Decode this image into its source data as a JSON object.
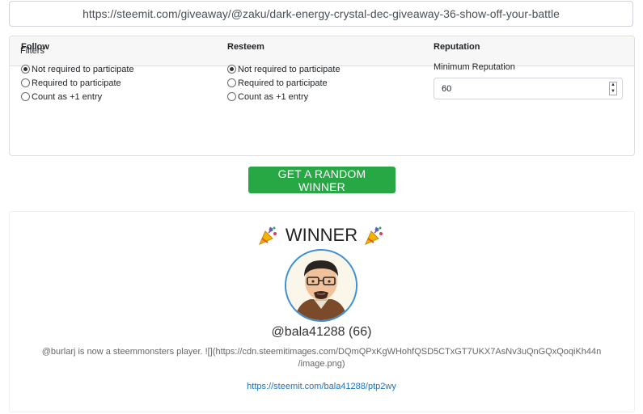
{
  "url": "https://steemit.com/giveaway/@zaku/dark-energy-crystal-dec-giveaway-36-show-off-your-battle",
  "filters": {
    "header": "Filters",
    "follow": {
      "title": "Follow",
      "options": [
        "Not required to participate",
        "Required to participate",
        "Count as +1 entry"
      ],
      "selected": "Not required to participate"
    },
    "resteem": {
      "title": "Resteem",
      "options": [
        "Not required to participate",
        "Required to participate",
        "Count as +1 entry"
      ],
      "selected": "Not required to participate"
    },
    "reputation": {
      "title": "Reputation",
      "min_label": "Minimum Reputation",
      "value": "60"
    }
  },
  "button": {
    "label": "GET A RANDOM WINNER",
    "color": "#28a745"
  },
  "winner": {
    "title": "WINNER",
    "icon": "party-popper-icon",
    "username": "@bala41288 (66)",
    "description_line1": "@burlarj is now a steemmonsters player. ![](https://cdn.steemitimages.com/DQmQPxKgWHohfQSD5CTxGT7UKX7AsNv3uQnGQxQoqiKh44n",
    "description_line2": "/image.png)",
    "link": "https://steemit.com/bala41288/ptp2wy"
  },
  "colors": {
    "link": "#1a73c4",
    "avatar_border": "#3b8fd4"
  }
}
